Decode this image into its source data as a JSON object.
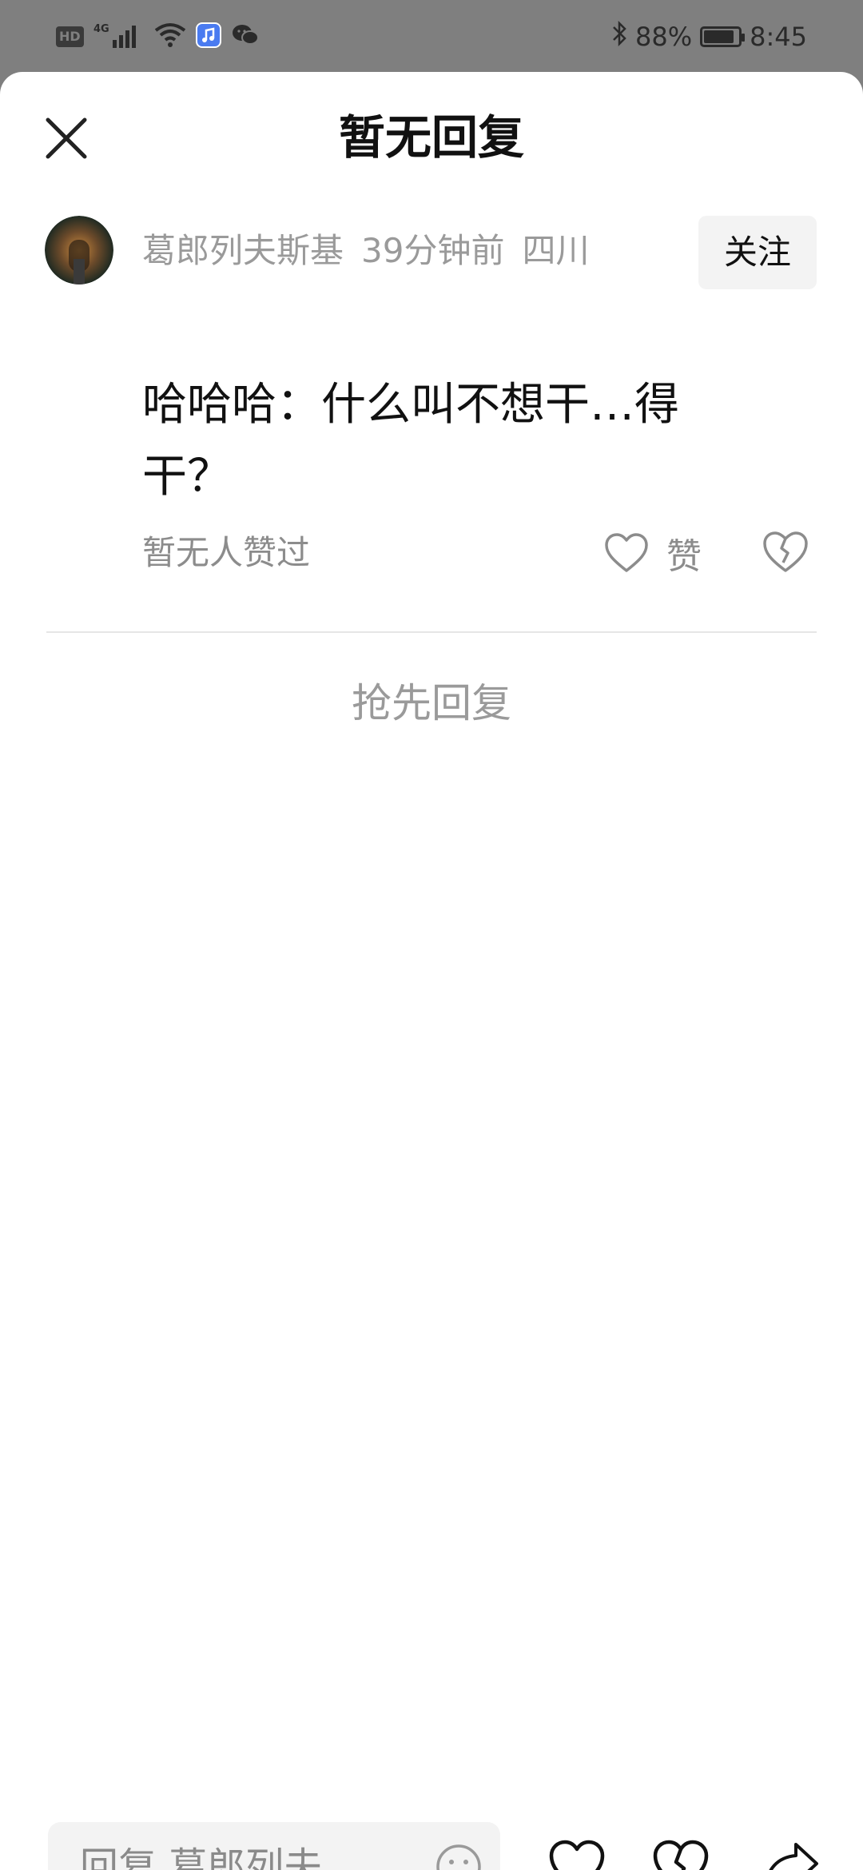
{
  "status_bar": {
    "hd": "HD",
    "network": "4G",
    "battery_percent": "88%",
    "battery_level": 0.88,
    "time": "8:45",
    "icons": [
      "hd-icon",
      "signal-icon",
      "wifi-icon",
      "music-app-icon",
      "wechat-icon",
      "bluetooth-icon",
      "battery-icon"
    ]
  },
  "sheet": {
    "title": "暂无回复",
    "close_icon": "close-icon"
  },
  "comment": {
    "username": "葛郎列夫斯基",
    "time_ago": "39分钟前",
    "location": "四川",
    "follow_label": "关注",
    "text": "哈哈哈：什么叫不想干…得干？",
    "likes_text": "暂无人赞过",
    "like_label": "赞",
    "like_icon": "heart-icon",
    "dislike_icon": "broken-heart-icon"
  },
  "replies": {
    "first_reply_label": "抢先回复"
  },
  "bottom_bar": {
    "input_placeholder": "回复 葛郎列夫...",
    "emoji_icon": "emoji-icon",
    "like_icon": "heart-icon",
    "dislike_icon": "broken-heart-icon",
    "share_icon": "share-icon"
  },
  "colors": {
    "status_bar_bg": "#7f7f7f",
    "sheet_bg": "#ffffff",
    "muted_text": "#9a9a9a",
    "primary_text": "#111111",
    "button_bg": "#f3f3f3"
  }
}
